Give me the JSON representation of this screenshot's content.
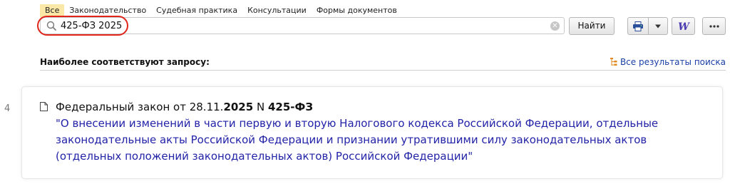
{
  "tabs": [
    {
      "label": "Все",
      "active": true
    },
    {
      "label": "Законодательство",
      "active": false
    },
    {
      "label": "Судебная практика",
      "active": false
    },
    {
      "label": "Консультации",
      "active": false
    },
    {
      "label": "Формы документов",
      "active": false
    }
  ],
  "search": {
    "query": "425-ФЗ 2025",
    "clear_icon": "close-icon",
    "search_icon": "search-icon",
    "highlight_color": "#e1251b"
  },
  "find_button": {
    "label": "Найти"
  },
  "toolbar": {
    "print_icon": "printer-icon",
    "dropdown_icon": "caret-down-icon",
    "word_icon": "word-icon",
    "more_icon": "more-dots-icon"
  },
  "results": {
    "heading": "Наиболее соответствуют запросу:",
    "all_results_label": "Все результаты поиска",
    "items": [
      {
        "number": "4",
        "title_prefix": "Федеральный закон от 28.11.",
        "title_year": "2025",
        "title_mid": " N ",
        "title_code": "425-ФЗ",
        "link_text": "\"О внесении изменений в части первую и вторую Налогового кодекса Российской Федерации, отдельные законодательные акты Российской Федерации и признании утратившими силу законодательных актов (отдельных положений законодательных актов) Российской Федерации\""
      }
    ]
  },
  "colors": {
    "tab_active_bg": "#fbe7a6",
    "link": "#2323a8",
    "all_results_link": "#1a3fa6",
    "word_icon": "#4a3bb0"
  }
}
